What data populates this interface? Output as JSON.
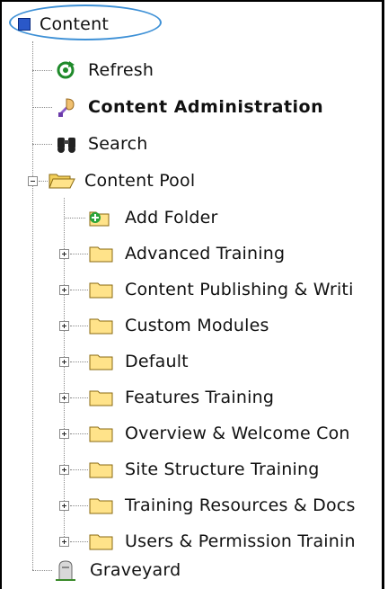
{
  "root": {
    "label": "Content"
  },
  "top_items": [
    {
      "label": "Refresh",
      "icon": "refresh-icon"
    },
    {
      "label": "Content Administration",
      "icon": "administration-icon"
    },
    {
      "label": "Search",
      "icon": "binoculars-icon"
    }
  ],
  "pool": {
    "label": "Content Pool",
    "icon": "open-folder-icon",
    "add_folder": {
      "label": "Add Folder",
      "icon": "add-folder-icon"
    },
    "folders": [
      {
        "label": "Advanced Training"
      },
      {
        "label": "Content Publishing & Writi"
      },
      {
        "label": "Custom Modules"
      },
      {
        "label": "Default"
      },
      {
        "label": "Features Training"
      },
      {
        "label": "Overview & Welcome Con"
      },
      {
        "label": "Site Structure Training"
      },
      {
        "label": "Training Resources & Docs"
      },
      {
        "label": "Users & Permission Trainin"
      }
    ]
  },
  "graveyard": {
    "label": "Graveyard",
    "icon": "tombstone-icon"
  },
  "colors": {
    "highlight_oval": "#3d90d6",
    "root_square": "#2a58c8",
    "folder": "#ffe38a"
  }
}
